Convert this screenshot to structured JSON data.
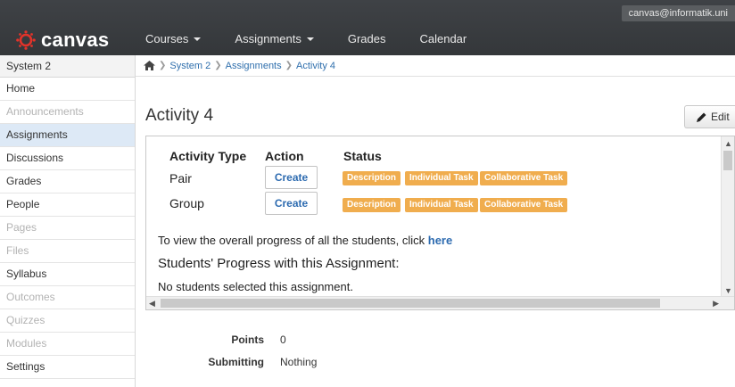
{
  "header": {
    "user": "canvas@informatik.uni",
    "logo_text": "canvas",
    "nav": [
      {
        "label": "Courses",
        "dropdown": true
      },
      {
        "label": "Assignments",
        "dropdown": true
      },
      {
        "label": "Grades",
        "dropdown": false
      },
      {
        "label": "Calendar",
        "dropdown": false
      }
    ]
  },
  "sidebar": {
    "course": "System 2",
    "items": [
      {
        "label": "Home",
        "state": "normal"
      },
      {
        "label": "Announcements",
        "state": "disabled"
      },
      {
        "label": "Assignments",
        "state": "active"
      },
      {
        "label": "Discussions",
        "state": "normal"
      },
      {
        "label": "Grades",
        "state": "normal"
      },
      {
        "label": "People",
        "state": "normal"
      },
      {
        "label": "Pages",
        "state": "disabled"
      },
      {
        "label": "Files",
        "state": "disabled"
      },
      {
        "label": "Syllabus",
        "state": "normal"
      },
      {
        "label": "Outcomes",
        "state": "disabled"
      },
      {
        "label": "Quizzes",
        "state": "disabled"
      },
      {
        "label": "Modules",
        "state": "disabled"
      },
      {
        "label": "Settings",
        "state": "normal"
      }
    ]
  },
  "breadcrumb": [
    "System 2",
    "Assignments",
    "Activity 4"
  ],
  "page": {
    "title": "Activity 4",
    "edit_label": "Edit"
  },
  "activity_table": {
    "headers": {
      "type": "Activity Type",
      "action": "Action",
      "status": "Status"
    },
    "rows": [
      {
        "type": "Pair",
        "action": "Create",
        "badges": [
          "Description",
          "Individual Task",
          "Collaborative Task"
        ]
      },
      {
        "type": "Group",
        "action": "Create",
        "badges": [
          "Description",
          "Individual Task",
          "Collaborative Task"
        ]
      }
    ]
  },
  "progress": {
    "text": "To view the overall progress of all the students, click ",
    "link": "here",
    "heading": "Students' Progress with this Assignment:",
    "empty": "No students selected this assignment."
  },
  "details": {
    "points_label": "Points",
    "points_value": "0",
    "submitting_label": "Submitting",
    "submitting_value": "Nothing"
  },
  "colors": {
    "topbar": "#3a3d40",
    "badge": "#f0ad4e",
    "link": "#2d6bb0",
    "active_sidebar": "#dde9f6"
  }
}
